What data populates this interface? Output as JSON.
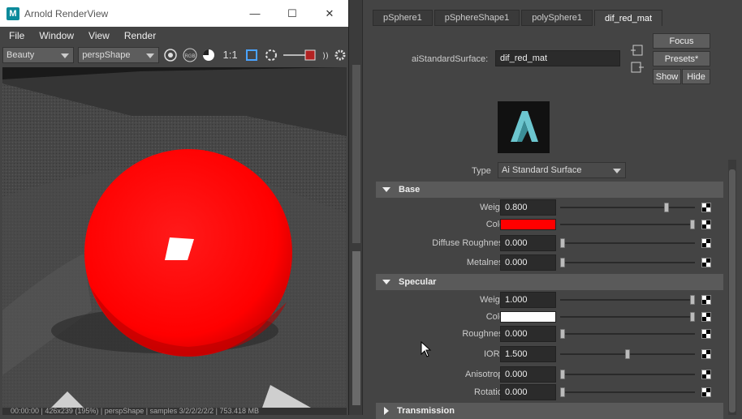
{
  "render_view": {
    "title": "Arnold RenderView",
    "app_icon_letter": "M",
    "window_controls": {
      "minimize": "—",
      "maximize": "☐",
      "close": "✕"
    },
    "menu": [
      "File",
      "Window",
      "View",
      "Render"
    ],
    "toolbar": {
      "aov": "Beauty",
      "camera": "perspShape",
      "ratio": "1:1",
      "rgb_label": "RGB"
    },
    "status": "00:00:00 | 426x239 (195%) | perspShape | samples 3/2/2/2/2/2 | 753.418 MB"
  },
  "attribute_editor": {
    "tabs": [
      "pSphere1",
      "pSphereShape1",
      "polySphere1",
      "dif_red_mat"
    ],
    "active_tab": "dif_red_mat",
    "node_label": "aiStandardSurface:",
    "node_name": "dif_red_mat",
    "buttons": {
      "focus": "Focus",
      "presets": "Presets*",
      "show": "Show",
      "hide": "Hide"
    },
    "type_label": "Type",
    "type_value": "Ai Standard Surface",
    "sections": {
      "base": {
        "title": "Base",
        "rows": [
          {
            "label": "Weight",
            "value": "0.800",
            "slider": 0.8
          },
          {
            "label": "Color",
            "color": "#ff0000",
            "slider": 1.0
          },
          {
            "label": "Diffuse Roughness",
            "value": "0.000",
            "slider": 0.0
          },
          {
            "label": "Metalness",
            "value": "0.000",
            "slider": 0.0
          }
        ]
      },
      "specular": {
        "title": "Specular",
        "rows": [
          {
            "label": "Weight",
            "value": "1.000",
            "slider": 1.0
          },
          {
            "label": "Color",
            "color": "#ffffff",
            "slider": 1.0
          },
          {
            "label": "Roughness",
            "value": "0.000",
            "slider": 0.0
          },
          {
            "label": "IOR ≡",
            "value": "1.500",
            "slider": 0.5
          },
          {
            "label": "Anisotropy",
            "value": "0.000",
            "slider": 0.0
          },
          {
            "label": "Rotation",
            "value": "0.000",
            "slider": 0.0
          }
        ]
      },
      "transmission": {
        "title": "Transmission"
      }
    }
  },
  "colors": {
    "material": "#ff0000",
    "panel": "#444444",
    "field": "#2b2b2b"
  }
}
